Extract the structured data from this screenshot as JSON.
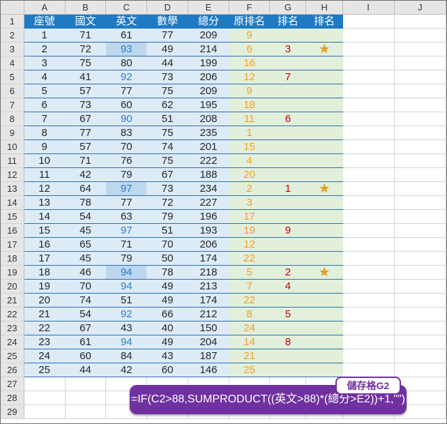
{
  "columns": [
    "A",
    "B",
    "C",
    "D",
    "E",
    "F",
    "G",
    "H",
    "I",
    "J"
  ],
  "row_numbers": [
    "1",
    "2",
    "3",
    "4",
    "5",
    "6",
    "7",
    "8",
    "9",
    "10",
    "11",
    "12",
    "13",
    "14",
    "15",
    "16",
    "17",
    "18",
    "19",
    "20",
    "21",
    "22",
    "23",
    "24",
    "25",
    "26",
    "27",
    "28",
    "29"
  ],
  "headers": [
    "座號",
    "國文",
    "英文",
    "數學",
    "總分",
    "原排名",
    "排名",
    "排名"
  ],
  "rows": [
    [
      "1",
      "71",
      "61",
      "77",
      "209",
      "9",
      "",
      ""
    ],
    [
      "2",
      "72",
      "93",
      "49",
      "214",
      "6",
      "3",
      "★"
    ],
    [
      "3",
      "75",
      "80",
      "44",
      "199",
      "16",
      "",
      ""
    ],
    [
      "4",
      "41",
      "92",
      "73",
      "206",
      "12",
      "7",
      ""
    ],
    [
      "5",
      "57",
      "77",
      "75",
      "209",
      "9",
      "",
      ""
    ],
    [
      "6",
      "73",
      "60",
      "62",
      "195",
      "18",
      "",
      ""
    ],
    [
      "7",
      "67",
      "90",
      "51",
      "208",
      "11",
      "6",
      ""
    ],
    [
      "8",
      "77",
      "83",
      "75",
      "235",
      "1",
      "",
      ""
    ],
    [
      "9",
      "57",
      "70",
      "74",
      "201",
      "15",
      "",
      ""
    ],
    [
      "10",
      "71",
      "76",
      "75",
      "222",
      "4",
      "",
      ""
    ],
    [
      "11",
      "42",
      "79",
      "67",
      "188",
      "20",
      "",
      ""
    ],
    [
      "12",
      "64",
      "97",
      "73",
      "234",
      "2",
      "1",
      "★"
    ],
    [
      "13",
      "78",
      "77",
      "72",
      "227",
      "3",
      "",
      ""
    ],
    [
      "14",
      "54",
      "63",
      "79",
      "196",
      "17",
      "",
      ""
    ],
    [
      "15",
      "45",
      "97",
      "51",
      "193",
      "19",
      "9",
      ""
    ],
    [
      "16",
      "65",
      "71",
      "70",
      "206",
      "12",
      "",
      ""
    ],
    [
      "17",
      "45",
      "79",
      "50",
      "174",
      "22",
      "",
      ""
    ],
    [
      "18",
      "46",
      "94",
      "78",
      "218",
      "5",
      "2",
      "★"
    ],
    [
      "19",
      "70",
      "94",
      "49",
      "213",
      "7",
      "4",
      ""
    ],
    [
      "20",
      "74",
      "51",
      "49",
      "174",
      "22",
      "",
      ""
    ],
    [
      "21",
      "54",
      "92",
      "66",
      "212",
      "8",
      "5",
      ""
    ],
    [
      "22",
      "67",
      "43",
      "40",
      "150",
      "24",
      "",
      ""
    ],
    [
      "23",
      "61",
      "94",
      "49",
      "204",
      "14",
      "8",
      ""
    ],
    [
      "24",
      "60",
      "84",
      "43",
      "187",
      "21",
      "",
      ""
    ],
    [
      "25",
      "44",
      "42",
      "60",
      "146",
      "25",
      "",
      ""
    ]
  ],
  "highlighted_english_rows": [
    2,
    12,
    18
  ],
  "colors": {
    "header_fill": "#1f7ac4",
    "data_fill": "#ddebf7",
    "rank_fill": "#e2efda",
    "highlight_fill": "#bdd7ee",
    "english_gt88_text": "#2a7fc7",
    "original_rank_text": "#f0a030",
    "new_rank_text": "#c00000",
    "star_color": "#e0a020",
    "callout_fill": "#7030a0"
  },
  "callout": {
    "tag": "儲存格G2",
    "formula": "=IF(C2>88,SUMPRODUCT((英文>88)*(總分>E2))+1,\"\")"
  }
}
